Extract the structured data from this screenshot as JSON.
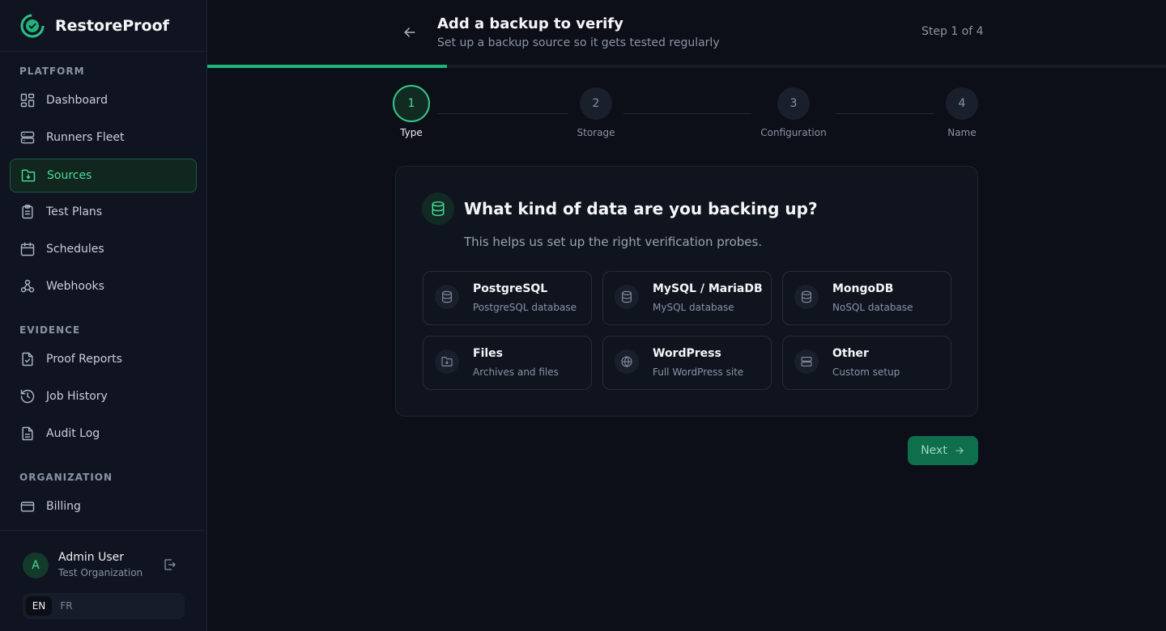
{
  "app": {
    "name": "RestoreProof"
  },
  "sidebar": {
    "sections": [
      {
        "label": "PLATFORM"
      },
      {
        "label": "EVIDENCE"
      },
      {
        "label": "ORGANIZATION"
      }
    ],
    "items": [
      {
        "label": "Dashboard",
        "icon": "dashboard-icon"
      },
      {
        "label": "Runners Fleet",
        "icon": "server-icon"
      },
      {
        "label": "Sources",
        "icon": "folder-icon",
        "active": true
      },
      {
        "label": "Test Plans",
        "icon": "clipboard-icon"
      },
      {
        "label": "Schedules",
        "icon": "calendar-icon"
      },
      {
        "label": "Webhooks",
        "icon": "webhook-icon"
      },
      {
        "label": "Proof Reports",
        "icon": "file-check-icon"
      },
      {
        "label": "Job History",
        "icon": "history-icon"
      },
      {
        "label": "Audit Log",
        "icon": "file-text-icon"
      },
      {
        "label": "Billing",
        "icon": "credit-card-icon"
      }
    ]
  },
  "user": {
    "initial": "A",
    "name": "Admin User",
    "org": "Test Organization"
  },
  "languages": {
    "en": "EN",
    "fr": "FR",
    "selected": "EN"
  },
  "header": {
    "title": "Add a backup to verify",
    "subtitle": "Set up a backup source so it gets tested regularly",
    "step_counter": "Step 1 of 4"
  },
  "progress": {
    "fraction": 0.25
  },
  "stepper": [
    {
      "number": "1",
      "label": "Type",
      "active": true
    },
    {
      "number": "2",
      "label": "Storage"
    },
    {
      "number": "3",
      "label": "Configuration"
    },
    {
      "number": "4",
      "label": "Name"
    }
  ],
  "question": {
    "title": "What kind of data are you backing up?",
    "subtitle": "This helps us set up the right verification probes."
  },
  "options": [
    {
      "title": "PostgreSQL",
      "desc": "PostgreSQL database",
      "icon": "database-icon"
    },
    {
      "title": "MySQL / MariaDB",
      "desc": "MySQL database",
      "icon": "database-icon"
    },
    {
      "title": "MongoDB",
      "desc": "NoSQL database",
      "icon": "database-icon"
    },
    {
      "title": "Files",
      "desc": "Archives and files",
      "icon": "folder-icon"
    },
    {
      "title": "WordPress",
      "desc": "Full WordPress site",
      "icon": "globe-icon"
    },
    {
      "title": "Other",
      "desc": "Custom setup",
      "icon": "server-icon"
    }
  ],
  "actions": {
    "next_label": "Next"
  },
  "colors": {
    "accent": "#4ade9a",
    "primary_button": "#0f6e4c",
    "background": "#0c0f17"
  }
}
